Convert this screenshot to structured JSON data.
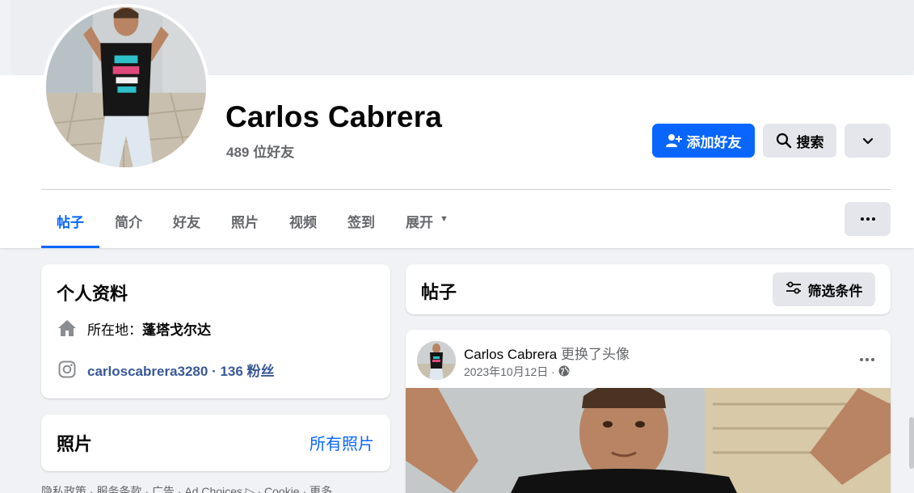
{
  "profile": {
    "name": "Carlos Cabrera",
    "friend_count": "489 位好友"
  },
  "actions": {
    "add_friend_label": "添加好友",
    "search_label": "搜索"
  },
  "tabs": [
    {
      "label": "帖子",
      "active": true
    },
    {
      "label": "简介"
    },
    {
      "label": "好友"
    },
    {
      "label": "照片"
    },
    {
      "label": "视频"
    },
    {
      "label": "签到"
    },
    {
      "label": "展开"
    }
  ],
  "intro": {
    "title": "个人资料",
    "location_label": "所在地：",
    "location_value": "蓬塔戈尔达",
    "instagram": "carloscabrera3280 · 136 粉丝"
  },
  "photos": {
    "title": "照片",
    "all_link": "所有照片"
  },
  "posts_header": {
    "title": "帖子",
    "filter_label": "筛选条件"
  },
  "post": {
    "author": "Carlos Cabrera",
    "action": "更换了头像",
    "date": "2023年10月12日 ·"
  },
  "footer": {
    "links": "隐私政策 · 服务条款 · 广告 · Ad Choices ▷ · Cookie · 更多"
  },
  "colors": {
    "accent": "#0866ff",
    "background": "#f0f2f5",
    "secondary_button": "#e4e6eb",
    "secondary_text": "#65676b"
  },
  "icons": {
    "add_friend": "add-friend-icon",
    "search": "search-icon",
    "dropdown": "chevron-down-icon",
    "more": "more-dots-icon",
    "location": "home-icon",
    "instagram": "instagram-icon",
    "filter": "filter-sliders-icon",
    "audience": "globe-icon"
  }
}
